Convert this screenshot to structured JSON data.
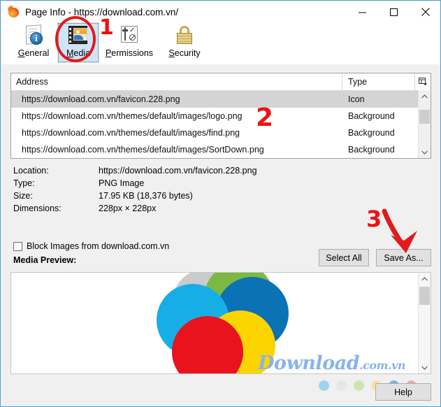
{
  "window": {
    "title": "Page Info - https://download.com.vn/",
    "app_icon": "firefox-icon",
    "minimize": "minimize-icon",
    "maximize": "maximize-icon",
    "close": "close-icon"
  },
  "toolbar": {
    "items": [
      {
        "label_pre": "",
        "label_accel": "G",
        "label_post": "eneral",
        "label": "General",
        "icon": "general-info-icon",
        "selected": false
      },
      {
        "label_pre": "",
        "label_accel": "M",
        "label_post": "edia",
        "label": "Media",
        "icon": "media-filmstrip-icon",
        "selected": true
      },
      {
        "label_pre": "",
        "label_accel": "P",
        "label_post": "ermissions",
        "label": "Permissions",
        "icon": "permissions-sliders-icon",
        "selected": false
      },
      {
        "label_pre": "",
        "label_accel": "S",
        "label_post": "ecurity",
        "label": "Security",
        "icon": "security-padlock-icon",
        "selected": false
      }
    ]
  },
  "media_list": {
    "columns": [
      "Address",
      "Type"
    ],
    "column_picker_icon": "column-picker-icon",
    "rows": [
      {
        "address": "https://download.com.vn/favicon.228.png",
        "type": "Icon",
        "selected": true
      },
      {
        "address": "https://download.com.vn/themes/default/images/logo.png",
        "type": "Background",
        "selected": false
      },
      {
        "address": "https://download.com.vn/themes/default/images/find.png",
        "type": "Background",
        "selected": false
      },
      {
        "address": "https://download.com.vn/themes/default/images/SortDown.png",
        "type": "Background",
        "selected": false
      }
    ],
    "scroll_up_icon": "chevron-up-icon",
    "scroll_down_icon": "chevron-down-icon"
  },
  "details": [
    {
      "label": "Location:",
      "value": "https://download.com.vn/favicon.228.png"
    },
    {
      "label": "Type:",
      "value": "PNG Image"
    },
    {
      "label": "Size:",
      "value": "17.95 KB (18,376 bytes)"
    },
    {
      "label": "Dimensions:",
      "value": "228px × 228px"
    }
  ],
  "block_images": {
    "label": "Block Images from download.com.vn",
    "checked": false
  },
  "media_preview_label": "Media Preview:",
  "buttons": {
    "select_all": "Select All",
    "save_as": "Save As...",
    "help": "Help"
  },
  "preview": {
    "watermark_main": "Download",
    "watermark_suffix": ".com.vn",
    "logo_colors": {
      "grey": "#c9cccb",
      "green": "#7cb942",
      "dark_blue": "#0a72b5",
      "light_blue": "#17aee6",
      "yellow": "#fcd500",
      "red": "#e8131c"
    },
    "scroll_up_icon": "chevron-up-icon",
    "scroll_down_icon": "chevron-down-icon"
  },
  "bottom_dots": [
    {
      "color": "#9fd3ef"
    },
    {
      "color": "#e6e6e6"
    },
    {
      "color": "#cfe5b0"
    },
    {
      "color": "#fadfae"
    },
    {
      "color": "#7ab4e0"
    },
    {
      "color": "#f4a8a8"
    }
  ],
  "annotations": [
    {
      "id": "1",
      "text": "1",
      "kind": "step-number-with-circle",
      "target": "Media tab"
    },
    {
      "id": "2",
      "text": "2",
      "kind": "step-number",
      "target": "media list"
    },
    {
      "id": "3",
      "text": "3",
      "kind": "step-number-with-arrow",
      "target": "Save As button"
    }
  ],
  "colors": {
    "annotation_red": "#ee1111",
    "window_border": "#4a9fd8",
    "selection_blue": "#cfe5f7",
    "row_selected": "#d4d4d4"
  }
}
